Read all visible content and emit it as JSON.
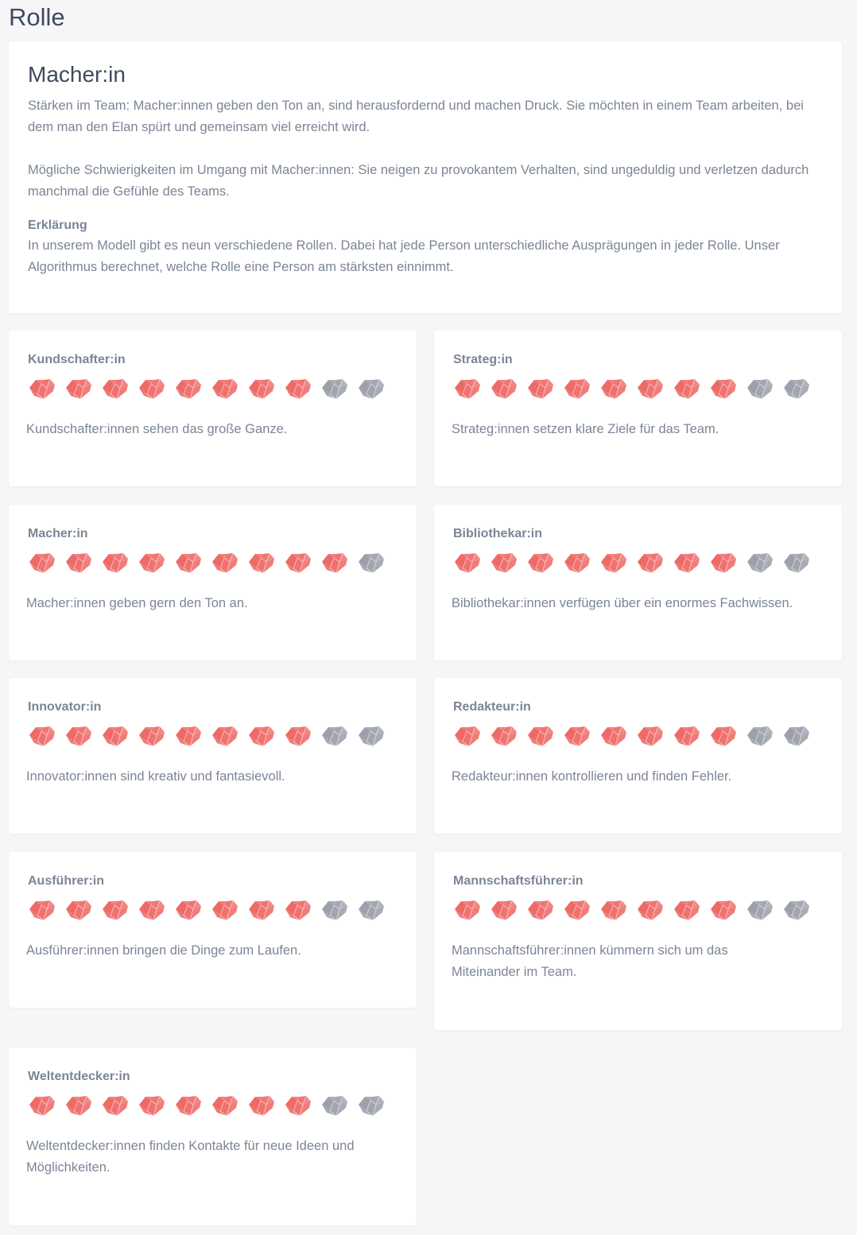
{
  "page": {
    "title": "Rolle"
  },
  "main": {
    "title": "Macher:in",
    "strengths": "Stärken im Team: Macher:innen geben den Ton an, sind herausfordernd und machen Druck. Sie möchten in einem Team arbeiten, bei dem man den Elan spürt und gemeinsam viel erreicht wird.",
    "difficulties": "Mögliche Schwierigkeiten im Umgang mit Macher:innen: Sie neigen zu provokantem Verhalten, sind ungeduldig und verletzen dadurch manchmal die Gefühle des Teams.",
    "explanation_heading": "Erklärung",
    "explanation": "In unserem Modell gibt es neun verschiedene Rollen. Dabei hat jede Person unterschiedliche Ausprägungen in jeder Rolle. Unser Algorithmus berechnet, welche Rolle eine Person am stärksten einnimmt."
  },
  "rating": {
    "max": 10,
    "color_on": "#ee6a67",
    "color_off": "#9ca0aa",
    "icon": "heart-icon"
  },
  "roles": [
    {
      "name": "Kundschafter:in",
      "score": 8,
      "description": "Kundschafter:innen sehen das große Ganze."
    },
    {
      "name": "Strateg:in",
      "score": 8,
      "description": "Strateg:innen setzen klare Ziele für das Team."
    },
    {
      "name": "Macher:in",
      "score": 9,
      "description": "Macher:innen geben gern den Ton an."
    },
    {
      "name": "Bibliothekar:in",
      "score": 8,
      "description": "Bibliothekar:innen verfügen über ein enormes Fachwissen."
    },
    {
      "name": "Innovator:in",
      "score": 8,
      "description": "Innovator:innen sind kreativ und fantasievoll."
    },
    {
      "name": "Redakteur:in",
      "score": 8,
      "description": "Redakteur:innen kontrollieren und finden Fehler."
    },
    {
      "name": "Ausführer:in",
      "score": 8,
      "description": "Ausführer:innen bringen die Dinge zum Laufen."
    },
    {
      "name": "Mannschaftsführer:in",
      "score": 8,
      "description": "Mannschaftsführer:innen kümmern sich um das Miteinander im Team."
    },
    {
      "name": "Weltentdecker:in",
      "score": 8,
      "description": "Weltentdecker:innen finden Kontakte für neue Ideen und Möglichkeiten."
    }
  ]
}
